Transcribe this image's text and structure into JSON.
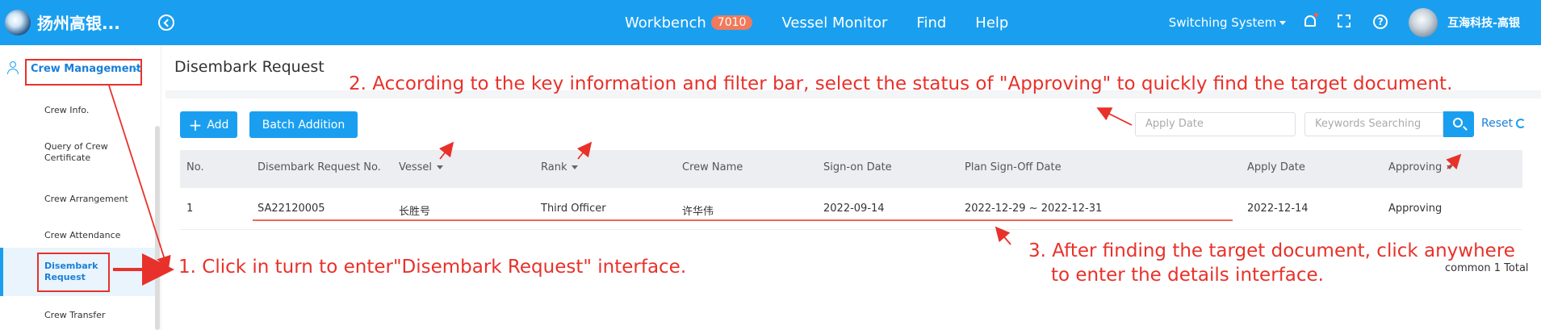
{
  "header": {
    "app_name": "扬州高银...",
    "nav": [
      {
        "label": "Workbench",
        "badge": "7010"
      },
      {
        "label": "Vessel Monitor"
      },
      {
        "label": "Find"
      },
      {
        "label": "Help"
      }
    ],
    "switch_system": "Switching System",
    "user_name": "互海科技-高银",
    "accent_color": "#1a9ff0"
  },
  "sidebar": {
    "parent_label": "Crew Management",
    "items": [
      {
        "label": "Crew Info."
      },
      {
        "label": "Query of Crew Certificate"
      },
      {
        "label": "Crew Arrangement"
      },
      {
        "label": "Crew Attendance"
      },
      {
        "label": "Disembark Request",
        "active": true
      },
      {
        "label": "Crew Transfer"
      }
    ]
  },
  "main": {
    "title": "Disembark Request",
    "buttons": {
      "add": "Add",
      "batch": "Batch Addition",
      "reset": "Reset"
    },
    "filters": {
      "apply_date_placeholder": "Apply Date",
      "keywords_placeholder": "Keywords Searching"
    },
    "table": {
      "headers": [
        "No.",
        "Disembark Request No.",
        "Vessel",
        "Rank",
        "Crew Name",
        "Sign-on Date",
        "Plan Sign-Off Date",
        "Apply Date",
        "Approving"
      ],
      "rows": [
        [
          "1",
          "SA22120005",
          "长胜号",
          "Third Officer",
          "许华伟",
          "2022-09-14",
          "2022-12-29 ~ 2022-12-31",
          "2022-12-14",
          "Approving"
        ]
      ]
    },
    "total": "common 1 Total"
  },
  "annotations": {
    "step1": "1. Click in turn to enter\"Disembark Request\" interface.",
    "step2": "2. According to the key information and filter bar, select the status of \"Approving\" to quickly find the target document.",
    "step3_line1": "3. After finding the target document, click anywhere",
    "step3_line2": "to enter the details interface.",
    "color": "#e8312a"
  }
}
